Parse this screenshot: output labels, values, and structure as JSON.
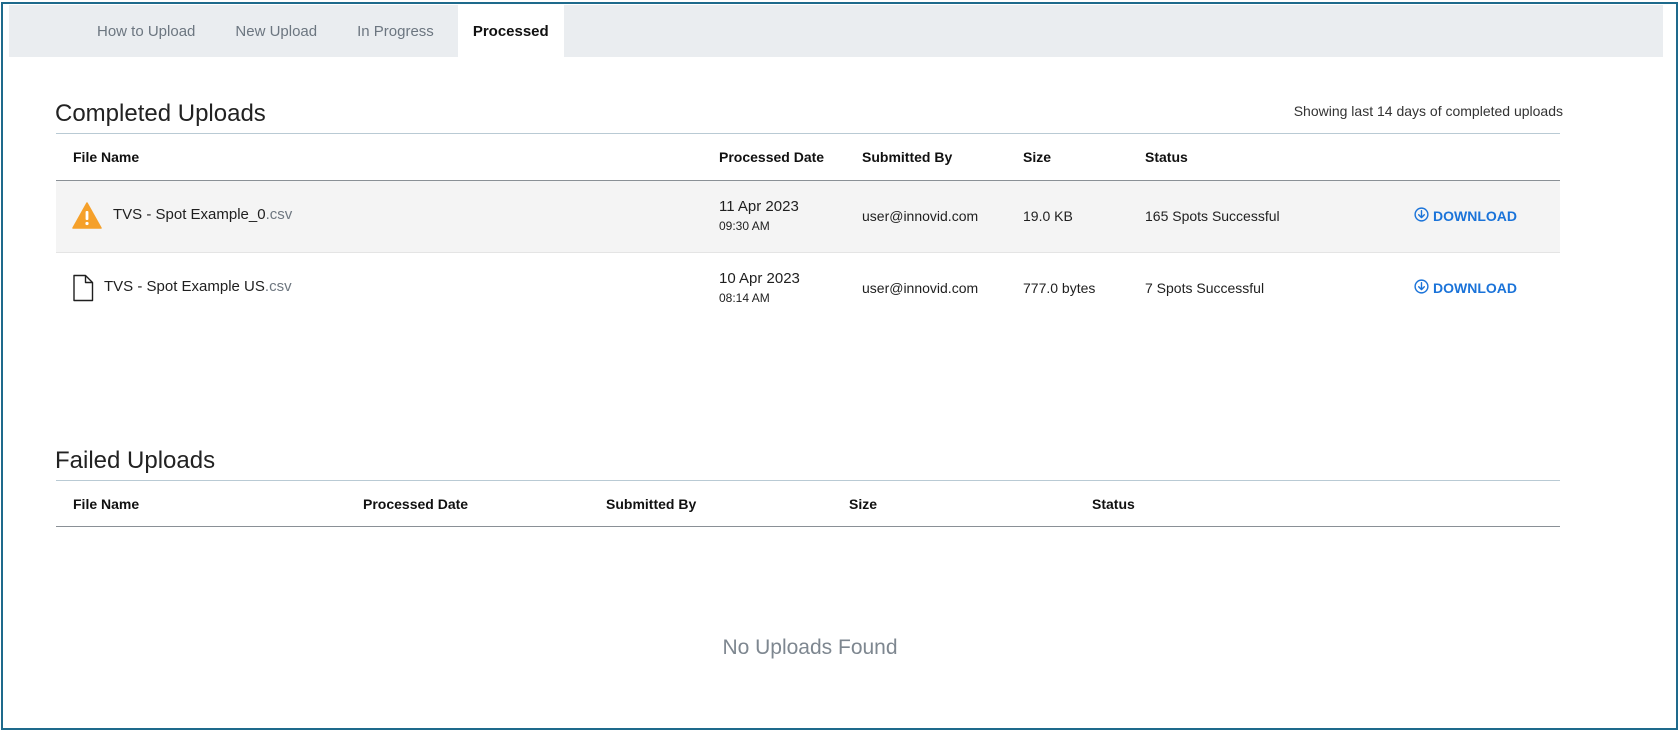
{
  "tabs": [
    {
      "label": "How to Upload"
    },
    {
      "label": "New Upload"
    },
    {
      "label": "In Progress"
    },
    {
      "label": "Processed"
    }
  ],
  "completed": {
    "title": "Completed Uploads",
    "note": "Showing last 14 days of completed uploads",
    "columns": [
      "File Name",
      "Processed Date",
      "Submitted By",
      "Size",
      "Status"
    ],
    "rows": [
      {
        "icon": "warning-icon",
        "file_base": "TVS - Spot Example_0",
        "file_ext": ".csv",
        "date": "11 Apr 2023",
        "time": "09:30 AM",
        "submitted_by": "user@innovid.com",
        "size": "19.0 KB",
        "status": "165 Spots Successful",
        "action": "DOWNLOAD"
      },
      {
        "icon": "file-icon",
        "file_base": "TVS - Spot Example US",
        "file_ext": ".csv",
        "date": "10 Apr 2023",
        "time": "08:14 AM",
        "submitted_by": "user@innovid.com",
        "size": "777.0 bytes",
        "status": "7 Spots Successful",
        "action": "DOWNLOAD"
      }
    ]
  },
  "failed": {
    "title": "Failed Uploads",
    "columns": [
      "File Name",
      "Processed Date",
      "Submitted By",
      "Size",
      "Status"
    ],
    "empty_text": "No Uploads Found"
  },
  "colors": {
    "accent": "#1a73d9",
    "warning": "#f5a02a",
    "frame": "#1e6a8c"
  }
}
